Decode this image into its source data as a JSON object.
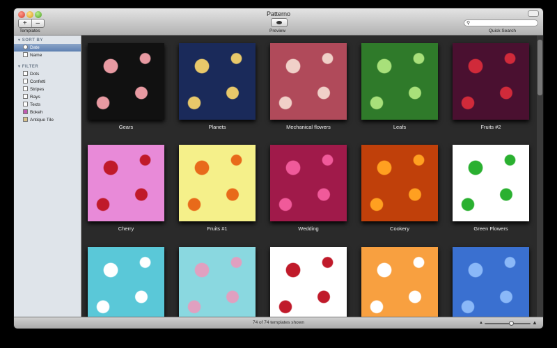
{
  "window": {
    "title": "Patterno"
  },
  "toolbar": {
    "add_label": "+",
    "remove_label": "–",
    "templates_label": "Templates",
    "preview_label": "Preview",
    "search_label": "Quick Search",
    "search_value": "",
    "search_icon": "magnifier-icon"
  },
  "sidebar": {
    "sort_header": "SORT BY",
    "sort_items": [
      {
        "label": "Date",
        "selected": true
      },
      {
        "label": "Name",
        "selected": false
      }
    ],
    "filter_header": "FILTER",
    "filter_items": [
      {
        "label": "Dots"
      },
      {
        "label": "Confetti"
      },
      {
        "label": "Stripes"
      },
      {
        "label": "Rays"
      },
      {
        "label": "Texts"
      },
      {
        "label": "Bokeh"
      },
      {
        "label": "Antique Tile"
      }
    ]
  },
  "templates": [
    {
      "name": "Gears",
      "bg": "#111111",
      "accent": "#e89aa2"
    },
    {
      "name": "Planets",
      "bg": "#1a2a5a",
      "accent": "#e8c86a"
    },
    {
      "name": "Mechanical flowers",
      "bg": "#b04a5a",
      "accent": "#f0d0c8"
    },
    {
      "name": "Leafs",
      "bg": "#2f7a2a",
      "accent": "#a8e07a"
    },
    {
      "name": "Fruits #2",
      "bg": "#4a1030",
      "accent": "#d02a3a"
    },
    {
      "name": "Cherry",
      "bg": "#e88ad8",
      "accent": "#c01a2a"
    },
    {
      "name": "Fruits #1",
      "bg": "#f5f08a",
      "accent": "#e86a1a"
    },
    {
      "name": "Wedding",
      "bg": "#a01a4a",
      "accent": "#f05a9a"
    },
    {
      "name": "Cookery",
      "bg": "#c0400a",
      "accent": "#ffa020"
    },
    {
      "name": "Green Flowers",
      "bg": "#ffffff",
      "accent": "#2ab030"
    },
    {
      "name": "",
      "bg": "#5ac8d8",
      "accent": "#ffffff"
    },
    {
      "name": "",
      "bg": "#8ad8e0",
      "accent": "#e0a0c0"
    },
    {
      "name": "",
      "bg": "#ffffff",
      "accent": "#c01a2a"
    },
    {
      "name": "",
      "bg": "#f8a040",
      "accent": "#ffffff"
    },
    {
      "name": "",
      "bg": "#3a70d0",
      "accent": "#8ab8f8"
    }
  ],
  "status": {
    "shown_text": "74 of 74 templates shown",
    "zoom_level": 0.6
  },
  "colors": {
    "selection": "#5d7fb0",
    "grid_bg": "#2a2a2a"
  }
}
